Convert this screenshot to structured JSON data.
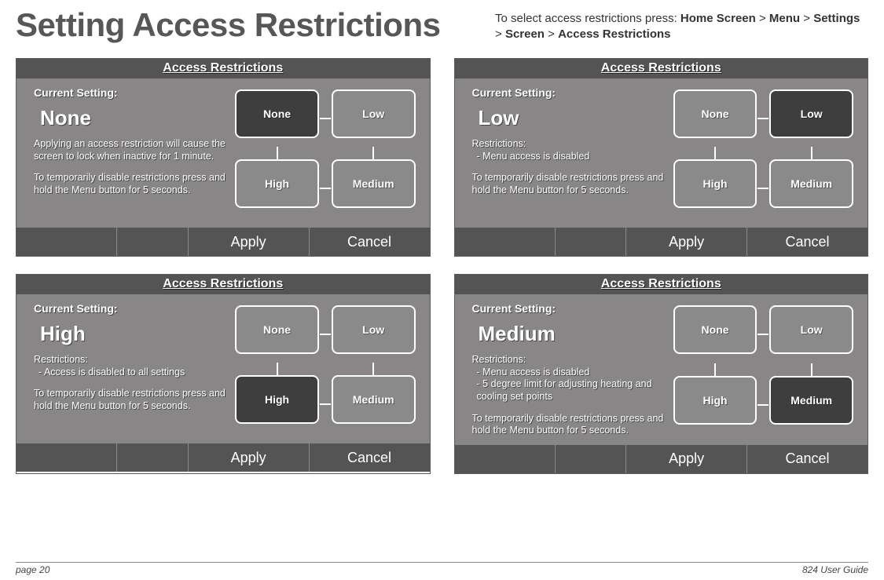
{
  "page": {
    "title": "Setting Access Restrictions",
    "nav_prefix": "To select access restrictions press:  ",
    "nav_path": [
      "Home Screen",
      "Menu",
      "Settings",
      "Screen",
      "Access Restrictions"
    ],
    "nav_sep": " > "
  },
  "common": {
    "panel_title": "Access Restrictions",
    "current_label": "Current Setting:",
    "restrictions_title": "Restrictions:",
    "disable_note": "To temporarily disable restrictions press and hold the Menu button for 5 seconds.",
    "apply": "Apply",
    "cancel": "Cancel",
    "options": {
      "none": "None",
      "low": "Low",
      "high": "High",
      "medium": "Medium"
    }
  },
  "panels": [
    {
      "value": "None",
      "selected": "none",
      "description": "Applying an access restriction will cause the screen to lock when inactive for 1 minute.",
      "restrictions": []
    },
    {
      "value": "Low",
      "selected": "low",
      "description": "",
      "restrictions": [
        "Menu access is disabled"
      ]
    },
    {
      "value": "High",
      "selected": "high",
      "description": "",
      "restrictions": [
        "Access is disabled to all settings"
      ]
    },
    {
      "value": "Medium",
      "selected": "medium",
      "description": "",
      "restrictions": [
        "Menu access is disabled",
        "5 degree limit for adjusting heating and cooling set points"
      ]
    }
  ],
  "footer": {
    "page_label": "page 20",
    "guide_label": "824 User Guide"
  }
}
